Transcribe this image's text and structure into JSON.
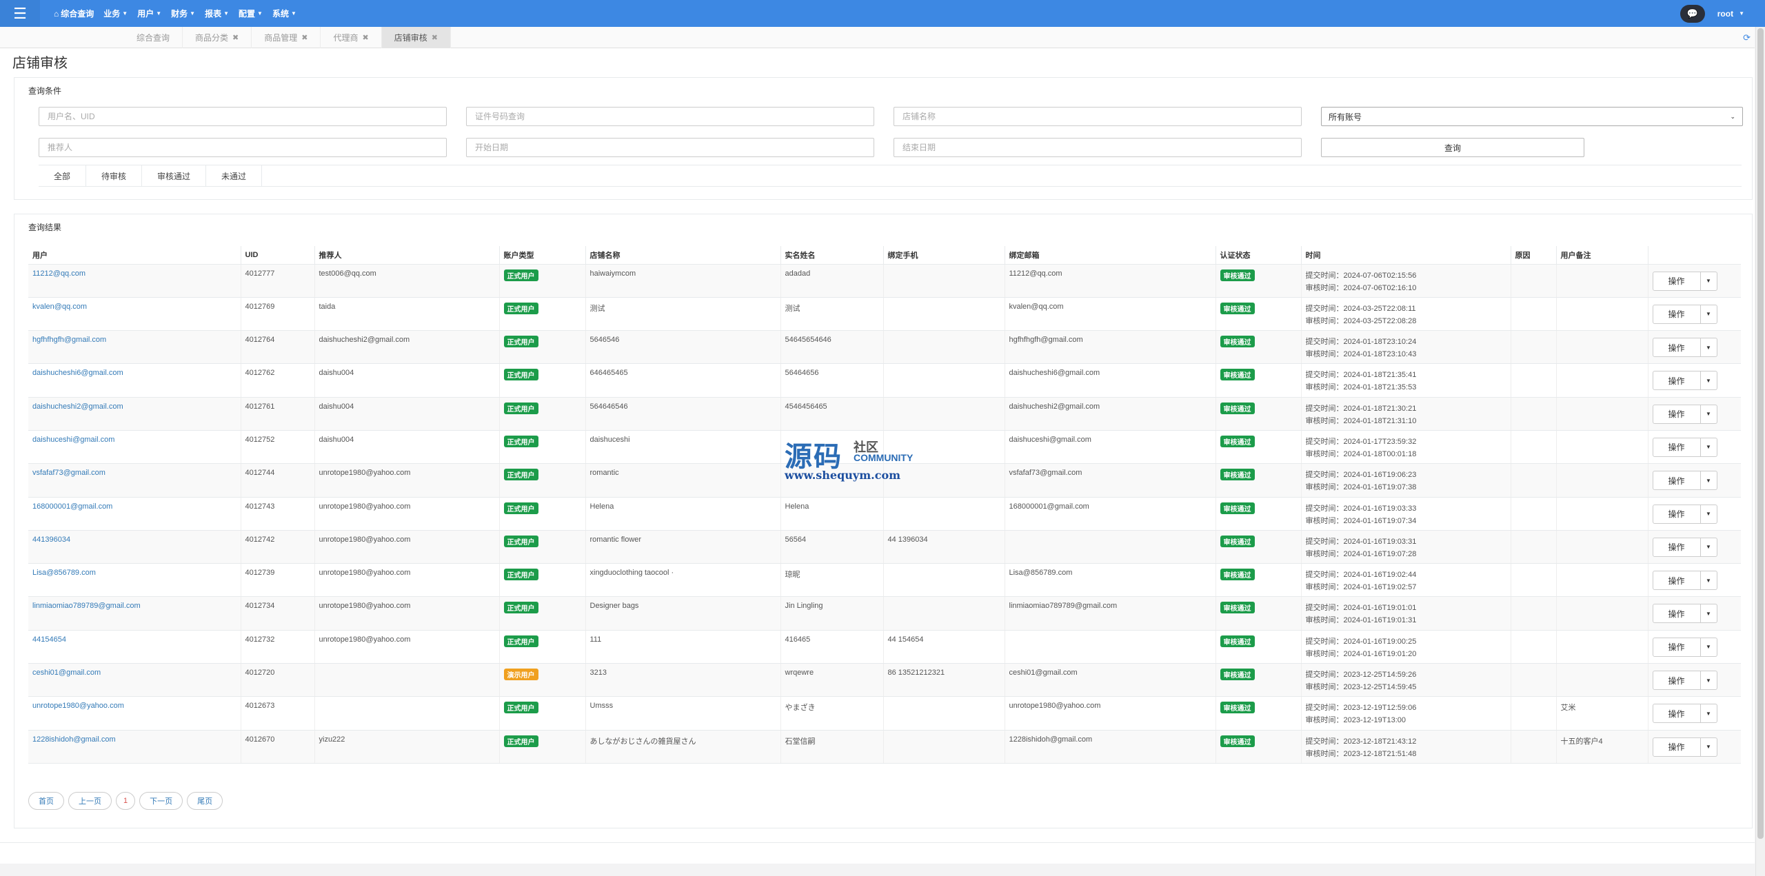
{
  "nav": {
    "items": [
      {
        "label": "综合查询",
        "icon": "home-icon",
        "caret": false
      },
      {
        "label": "业务",
        "caret": true
      },
      {
        "label": "用户",
        "caret": true
      },
      {
        "label": "财务",
        "caret": true
      },
      {
        "label": "报表",
        "caret": true
      },
      {
        "label": "配置",
        "caret": true
      },
      {
        "label": "系统",
        "caret": true
      }
    ],
    "user": "root"
  },
  "tabs": [
    {
      "label": "综合查询",
      "closable": false,
      "active": false
    },
    {
      "label": "商品分类",
      "closable": true,
      "active": false
    },
    {
      "label": "商品管理",
      "closable": true,
      "active": false
    },
    {
      "label": "代理商",
      "closable": true,
      "active": false
    },
    {
      "label": "店铺审核",
      "closable": true,
      "active": true
    }
  ],
  "page": {
    "title": "店铺审核"
  },
  "filters": {
    "title": "查询条件",
    "user_placeholder": "用户名、UID",
    "cert_placeholder": "证件号码查询",
    "shop_placeholder": "店铺名称",
    "account_select": "所有账号",
    "referrer_placeholder": "推荐人",
    "start_placeholder": "开始日期",
    "end_placeholder": "结束日期",
    "query_label": "查询",
    "status_tabs": [
      "全部",
      "待审核",
      "审核通过",
      "未通过"
    ]
  },
  "results": {
    "title": "查询结果",
    "columns": [
      "用户",
      "UID",
      "推荐人",
      "账户类型",
      "店铺名称",
      "实名姓名",
      "绑定手机",
      "绑定邮箱",
      "认证状态",
      "时间",
      "原因",
      "用户备注",
      ""
    ],
    "op_label": "操作",
    "submit_prefix": "提交时间：",
    "review_prefix": "审核时间：",
    "rows": [
      {
        "user": "11212@qq.com",
        "uid": "4012777",
        "ref": "test006@qq.com",
        "type": "正式用户",
        "type_color": "green",
        "shop": "haiwaiymcom",
        "name": "adadad",
        "phone": "",
        "email": "11212@qq.com",
        "status": "审核通过",
        "submit": "2024-07-06T02:15:56",
        "review": "2024-07-06T02:16:10",
        "reason": "",
        "note": ""
      },
      {
        "user": "kvalen@qq.com",
        "uid": "4012769",
        "ref": "taida",
        "type": "正式用户",
        "type_color": "green",
        "shop": "测试",
        "name": "测试",
        "phone": "",
        "email": "kvalen@qq.com",
        "status": "审核通过",
        "submit": "2024-03-25T22:08:11",
        "review": "2024-03-25T22:08:28",
        "reason": "",
        "note": ""
      },
      {
        "user": "hgfhfhgfh@gmail.com",
        "uid": "4012764",
        "ref": "daishucheshi2@gmail.com",
        "type": "正式用户",
        "type_color": "green",
        "shop": "5646546",
        "name": "54645654646",
        "phone": "",
        "email": "hgfhfhgfh@gmail.com",
        "status": "审核通过",
        "submit": "2024-01-18T23:10:24",
        "review": "2024-01-18T23:10:43",
        "reason": "",
        "note": ""
      },
      {
        "user": "daishucheshi6@gmail.com",
        "uid": "4012762",
        "ref": "daishu004",
        "type": "正式用户",
        "type_color": "green",
        "shop": "646465465",
        "name": "56464656",
        "phone": "",
        "email": "daishucheshi6@gmail.com",
        "status": "审核通过",
        "submit": "2024-01-18T21:35:41",
        "review": "2024-01-18T21:35:53",
        "reason": "",
        "note": ""
      },
      {
        "user": "daishucheshi2@gmail.com",
        "uid": "4012761",
        "ref": "daishu004",
        "type": "正式用户",
        "type_color": "green",
        "shop": "564646546",
        "name": "4546456465",
        "phone": "",
        "email": "daishucheshi2@gmail.com",
        "status": "审核通过",
        "submit": "2024-01-18T21:30:21",
        "review": "2024-01-18T21:31:10",
        "reason": "",
        "note": ""
      },
      {
        "user": "daishuceshi@gmail.com",
        "uid": "4012752",
        "ref": "daishu004",
        "type": "正式用户",
        "type_color": "green",
        "shop": "daishuceshi",
        "name": "",
        "phone": "",
        "email": "daishuceshi@gmail.com",
        "status": "审核通过",
        "submit": "2024-01-17T23:59:32",
        "review": "2024-01-18T00:01:18",
        "reason": "",
        "note": ""
      },
      {
        "user": "vsfafaf73@gmail.com",
        "uid": "4012744",
        "ref": "unrotope1980@yahoo.com",
        "type": "正式用户",
        "type_color": "green",
        "shop": "romantic",
        "name": "",
        "phone": "",
        "email": "vsfafaf73@gmail.com",
        "status": "审核通过",
        "submit": "2024-01-16T19:06:23",
        "review": "2024-01-16T19:07:38",
        "reason": "",
        "note": ""
      },
      {
        "user": "168000001@gmail.com",
        "uid": "4012743",
        "ref": "unrotope1980@yahoo.com",
        "type": "正式用户",
        "type_color": "green",
        "shop": "Helena",
        "name": "Helena",
        "phone": "",
        "email": "168000001@gmail.com",
        "status": "审核通过",
        "submit": "2024-01-16T19:03:33",
        "review": "2024-01-16T19:07:34",
        "reason": "",
        "note": ""
      },
      {
        "user": "441396034",
        "uid": "4012742",
        "ref": "unrotope1980@yahoo.com",
        "type": "正式用户",
        "type_color": "green",
        "shop": "romantic flower",
        "name": "56564",
        "phone": "44 1396034",
        "email": "",
        "status": "审核通过",
        "submit": "2024-01-16T19:03:31",
        "review": "2024-01-16T19:07:28",
        "reason": "",
        "note": ""
      },
      {
        "user": "Lisa@856789.com",
        "uid": "4012739",
        "ref": "unrotope1980@yahoo.com",
        "type": "正式用户",
        "type_color": "green",
        "shop": "xingduoclothing taocool ·",
        "name": "琼昵",
        "phone": "",
        "email": "Lisa@856789.com",
        "status": "审核通过",
        "submit": "2024-01-16T19:02:44",
        "review": "2024-01-16T19:02:57",
        "reason": "",
        "note": ""
      },
      {
        "user": "linmiaomiao789789@gmail.com",
        "uid": "4012734",
        "ref": "unrotope1980@yahoo.com",
        "type": "正式用户",
        "type_color": "green",
        "shop": "Designer bags",
        "name": "Jin Lingling",
        "phone": "",
        "email": "linmiaomiao789789@gmail.com",
        "status": "审核通过",
        "submit": "2024-01-16T19:01:01",
        "review": "2024-01-16T19:01:31",
        "reason": "",
        "note": ""
      },
      {
        "user": "44154654",
        "uid": "4012732",
        "ref": "unrotope1980@yahoo.com",
        "type": "正式用户",
        "type_color": "green",
        "shop": "111",
        "name": "416465",
        "phone": "44 154654",
        "email": "",
        "status": "审核通过",
        "submit": "2024-01-16T19:00:25",
        "review": "2024-01-16T19:01:20",
        "reason": "",
        "note": ""
      },
      {
        "user": "ceshi01@gmail.com",
        "uid": "4012720",
        "ref": "",
        "type": "演示用户",
        "type_color": "orange",
        "shop": "3213",
        "name": "wrqewre",
        "phone": "86 13521212321",
        "email": "ceshi01@gmail.com",
        "status": "审核通过",
        "submit": "2023-12-25T14:59:26",
        "review": "2023-12-25T14:59:45",
        "reason": "",
        "note": ""
      },
      {
        "user": "unrotope1980@yahoo.com",
        "uid": "4012673",
        "ref": "",
        "type": "正式用户",
        "type_color": "green",
        "shop": "Umsss",
        "name": "やまざき",
        "phone": "",
        "email": "unrotope1980@yahoo.com",
        "status": "审核通过",
        "submit": "2023-12-19T12:59:06",
        "review": "2023-12-19T13:00",
        "reason": "",
        "note": "艾米"
      },
      {
        "user": "1228ishidoh@gmail.com",
        "uid": "4012670",
        "ref": "yizu222",
        "type": "正式用户",
        "type_color": "green",
        "shop": "あしながおじさんの雑貨屋さん",
        "name": "石堂信嗣",
        "phone": "",
        "email": "1228ishidoh@gmail.com",
        "status": "审核通过",
        "submit": "2023-12-18T21:43:12",
        "review": "2023-12-18T21:51:48",
        "reason": "",
        "note": "十五的客户4"
      }
    ]
  },
  "pagination": {
    "first": "首页",
    "prev": "上一页",
    "current": "1",
    "next": "下一页",
    "last": "尾页"
  },
  "watermark": {
    "big": "源码",
    "small": "社区",
    "community": "COMMUNITY",
    "url": "www.shequym.com"
  }
}
